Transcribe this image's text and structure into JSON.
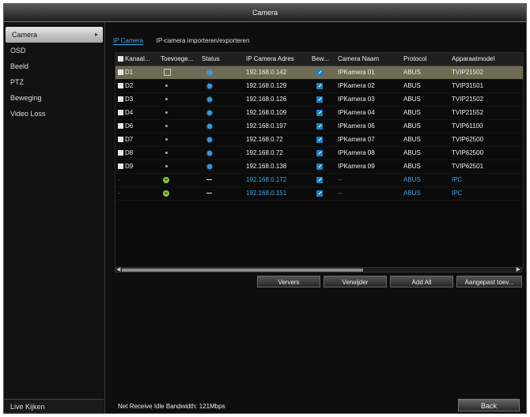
{
  "window": {
    "title": "Camera"
  },
  "sidebar": {
    "items": [
      "Camera",
      "OSD",
      "Beeld",
      "PTZ",
      "Beweging",
      "Video Loss"
    ],
    "bottom": "Live Kijken"
  },
  "tabs": [
    "IP Camera",
    "IP-camera importeren/exporteren"
  ],
  "table": {
    "columns": [
      "Kanaal...",
      "Toevoege...",
      "Status",
      "IP Camera Adres",
      "Bew...",
      "Camera Naam",
      "Protocol",
      "Apparaatmodel"
    ],
    "rows": [
      {
        "ch": "D1",
        "ip": "192.168.0.142",
        "name": "IPKamera 01",
        "proto": "ABUS",
        "model": "TVIP21502"
      },
      {
        "ch": "D2",
        "ip": "192.168.0.129",
        "name": "IPKamera 02",
        "proto": "ABUS",
        "model": "TVIP31501"
      },
      {
        "ch": "D3",
        "ip": "192.168.0.126",
        "name": "IPKamera 03",
        "proto": "ABUS",
        "model": "TVIP21502"
      },
      {
        "ch": "D4",
        "ip": "192.168.0.109",
        "name": "IPKamera 04",
        "proto": "ABUS",
        "model": "TVIP21552"
      },
      {
        "ch": "D6",
        "ip": "192.168.0.197",
        "name": "IPKamera 06",
        "proto": "ABUS",
        "model": "TVIP61100"
      },
      {
        "ch": "D7",
        "ip": "192.168.0.72",
        "name": "IPKamera 07",
        "proto": "ABUS",
        "model": "TVIP62500"
      },
      {
        "ch": "D8",
        "ip": "192.168.0.72",
        "name": "IPKamera 08",
        "proto": "ABUS",
        "model": "TVIP62500"
      },
      {
        "ch": "D9",
        "ip": "192.168.0.138",
        "name": "IPKamera 09",
        "proto": "ABUS",
        "model": "TVIP62501"
      }
    ],
    "new_rows": [
      {
        "ch": "-",
        "ip": "192.168.0.172",
        "name": "--",
        "proto": "ABUS",
        "model": "IPC"
      },
      {
        "ch": "-",
        "ip": "192.168.0.151",
        "name": "--",
        "proto": "ABUS",
        "model": "IPC"
      }
    ]
  },
  "buttons": {
    "refresh": "Ververs",
    "delete": "Verwijder",
    "add_all": "Add All",
    "custom_add": "Aangepast toev...",
    "back": "Back"
  },
  "status": {
    "bandwidth": "Net Receive Idle Bandwidth: 121Mbps"
  },
  "colors": {
    "accent": "#3aa6e8",
    "selected_row": "#6e6b55",
    "status_ok": "#2e9bea",
    "add_icon": "#8cc63f"
  }
}
